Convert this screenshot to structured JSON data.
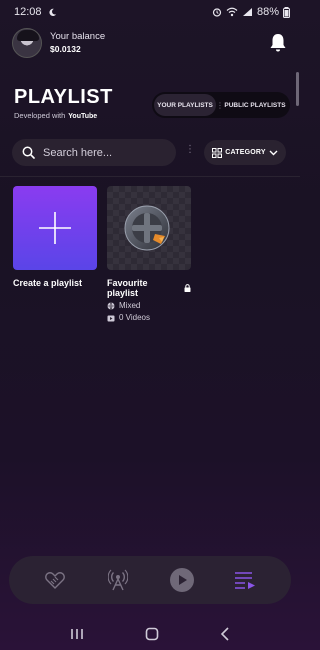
{
  "status_bar": {
    "time": "12:08",
    "battery": "88%"
  },
  "header": {
    "balance_label": "Your balance",
    "balance_value": "$0.0132"
  },
  "page": {
    "title": "PLAYLIST",
    "subtitle_prefix": "Developed with",
    "subtitle_brand": "YouTube"
  },
  "tabs": {
    "your_playlists": "YOUR PLAYLISTS",
    "public_playlists": "PUBLIC PLAYLISTS",
    "active": "your_playlists"
  },
  "search": {
    "placeholder": "Search here..."
  },
  "category": {
    "label": "CATEGORY"
  },
  "playlists": [
    {
      "title": "Create a playlist"
    },
    {
      "title": "Favourite playlist",
      "visibility": "Mixed",
      "videos": "0 Videos"
    }
  ],
  "colors": {
    "accent_purple": "#8a3cf0",
    "accent_blue": "#5a45e8",
    "active_nav": "#8a55e8"
  },
  "icons": {
    "nav": [
      "handshake-icon",
      "broadcast-icon",
      "play-icon",
      "playlist-icon"
    ],
    "active_nav": "playlist-icon"
  }
}
